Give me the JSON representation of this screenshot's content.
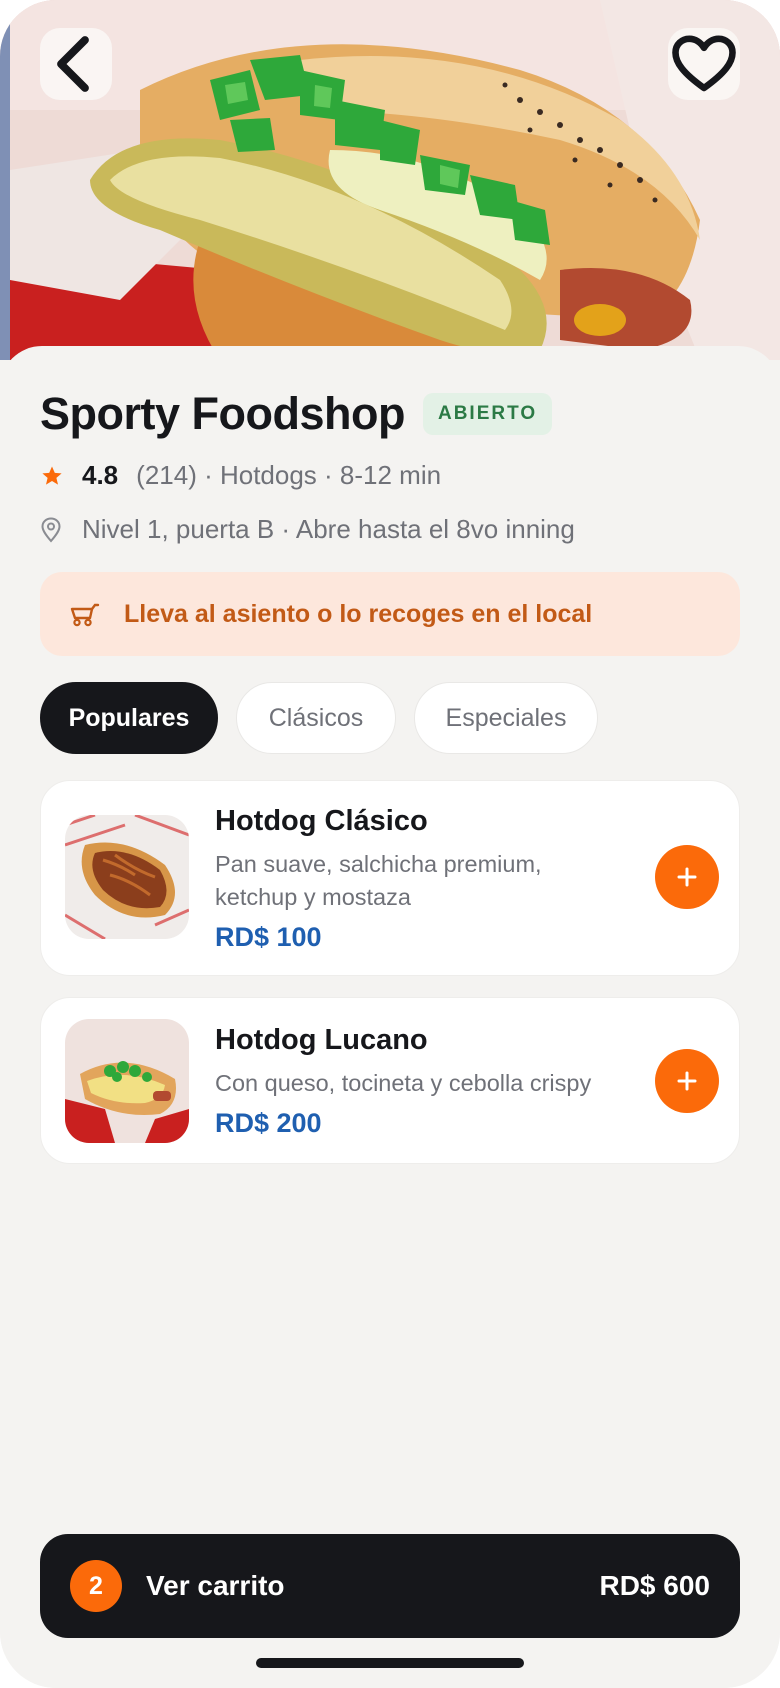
{
  "hero": {
    "back_icon": "chevron-left-icon",
    "favorite_icon": "heart-icon"
  },
  "restaurant": {
    "name": "Sporty Foodshop",
    "status": "ABIERTO",
    "rating": "4.8",
    "details": "(214) · Hotdogs · 8-12 min",
    "location": "Nivel 1, puerta B · Abre hasta el 8vo inning"
  },
  "banner": {
    "text": "Lleva al asiento o lo recoges en el local",
    "icon": "cart-icon"
  },
  "tabs": [
    {
      "label": "Populares",
      "active": true
    },
    {
      "label": "Clásicos",
      "active": false
    },
    {
      "label": "Especiales",
      "active": false
    }
  ],
  "menu_items": [
    {
      "name": "Hotdog Clásico",
      "description": "Pan suave, salchicha premium, ketchup y mostaza",
      "price": "RD$ 100"
    },
    {
      "name": "Hotdog Lucano",
      "description": "Con queso, tocineta y cebolla crispy",
      "price": "RD$ 200"
    }
  ],
  "cart": {
    "count": "2",
    "label": "Ver carrito",
    "total": "RD$ 600"
  },
  "colors": {
    "accent": "#fb6a0a",
    "price": "#1f5fb0",
    "dark": "#16171b",
    "open_green": "#2b7a45"
  }
}
